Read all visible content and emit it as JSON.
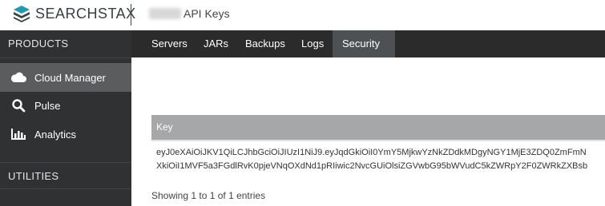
{
  "header": {
    "brand": "SEARCHSTAX",
    "page_title": "API Keys"
  },
  "sidebar": {
    "products_label": "PRODUCTS",
    "items": [
      {
        "label": "Cloud Manager",
        "icon": "cloud-icon",
        "active": true
      },
      {
        "label": "Pulse",
        "icon": "search-icon",
        "active": false
      },
      {
        "label": "Analytics",
        "icon": "bar-chart-icon",
        "active": false
      }
    ],
    "utilities_label": "UTILITIES"
  },
  "navbar": {
    "tabs": [
      {
        "label": "Servers",
        "active": false
      },
      {
        "label": "JARs",
        "active": false
      },
      {
        "label": "Backups",
        "active": false
      },
      {
        "label": "Logs",
        "active": false
      },
      {
        "label": "Security",
        "active": true,
        "dropdown": true
      }
    ]
  },
  "table": {
    "columns": [
      "Key"
    ],
    "rows": [
      {
        "key_line1": "eyJ0eXAiOiJKV1QiLCJhbGciOiJIUzI1NiJ9.eyJqdGkiOiI0YmY5MjkwYzNkZDdkMDgyNGY1MjE3ZDQ0ZmFmN",
        "key_line2": "XkiOiI1MVF5a3FGdlRvK0pjeVNqOXdNd1pRIiwic2NvcGUiOlsiZGVwbG95bWVudC5kZWRpY2F0ZWRkZXBsb"
      }
    ],
    "footer": "Showing 1 to 1 of 1 entries"
  },
  "colors": {
    "sidebar_bg": "#2f3133",
    "sidebar_active": "#5a5c5e",
    "navbar_bg": "#2b2b2b",
    "navbar_active": "#4e5154",
    "table_header_bg": "#a6a7a8",
    "brand_teal": "#1e9bb0"
  }
}
